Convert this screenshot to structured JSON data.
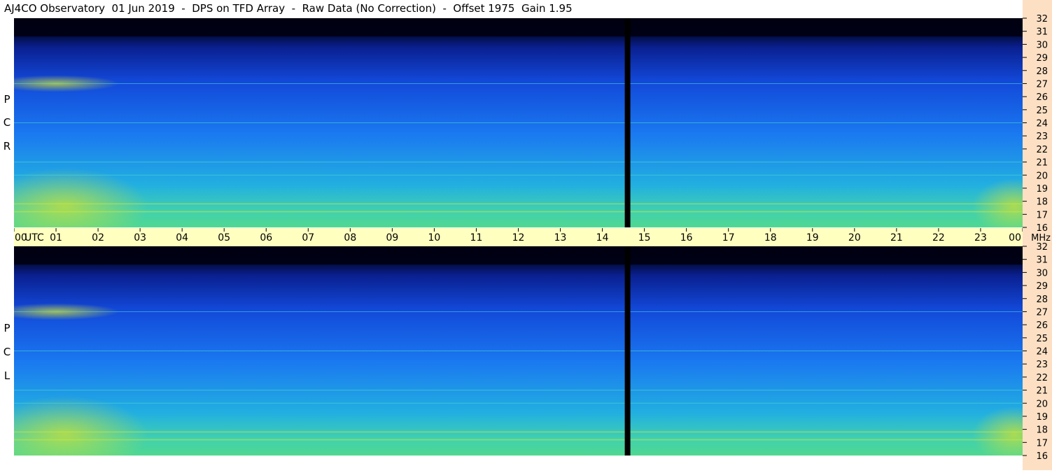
{
  "title": "AJ4CO Observatory  01 Jun 2019  -  DPS on TFD Array  -  Raw Data (No Correction)  -  Offset 1975  Gain 1.95",
  "colors": {
    "time_axis_bg": "#ffffc0",
    "freq_axis_bg": "#fde0c4",
    "spectrogram_low": "#000028",
    "spectrogram_mid": "#1a60ff",
    "spectrogram_high": "#33d0d0",
    "spectrogram_peak": "#d0e030",
    "gap": "#000000"
  },
  "chart_data": {
    "type": "heatmap",
    "title": "AJ4CO Observatory  01 Jun 2019  -  DPS on TFD Array  -  Raw Data (No Correction)  -  Offset 1975  Gain 1.95",
    "colormap": "jet",
    "x_axis": {
      "labels": [
        "00",
        "UTC",
        "01",
        "02",
        "03",
        "04",
        "05",
        "06",
        "07",
        "08",
        "09",
        "10",
        "11",
        "12",
        "13",
        "14",
        "15",
        "16",
        "17",
        "18",
        "19",
        "20",
        "21",
        "22",
        "23",
        "00"
      ],
      "ticks": [
        0,
        1,
        2,
        3,
        4,
        5,
        6,
        7,
        8,
        9,
        10,
        11,
        12,
        13,
        14,
        15,
        16,
        17,
        18,
        19,
        20,
        21,
        22,
        23,
        24
      ],
      "range": [
        0,
        24
      ]
    },
    "y_axis": {
      "unit": "MHz",
      "ticks": [
        "16",
        "17",
        "18",
        "19",
        "20",
        "21",
        "22",
        "23",
        "24",
        "25",
        "26",
        "27",
        "28",
        "29",
        "30",
        "31",
        "32"
      ],
      "range": [
        16,
        32
      ]
    },
    "gap_utc": 14.6,
    "panels": [
      {
        "label": [
          "R",
          "C",
          "P"
        ],
        "range_y": [
          16,
          32
        ]
      },
      {
        "label": [
          "L",
          "C",
          "P"
        ],
        "range_y": [
          16,
          32
        ]
      }
    ],
    "persistent_signals_mhz": [
      17.2,
      17.8,
      20.0,
      21.0,
      24.0,
      27.0
    ]
  }
}
